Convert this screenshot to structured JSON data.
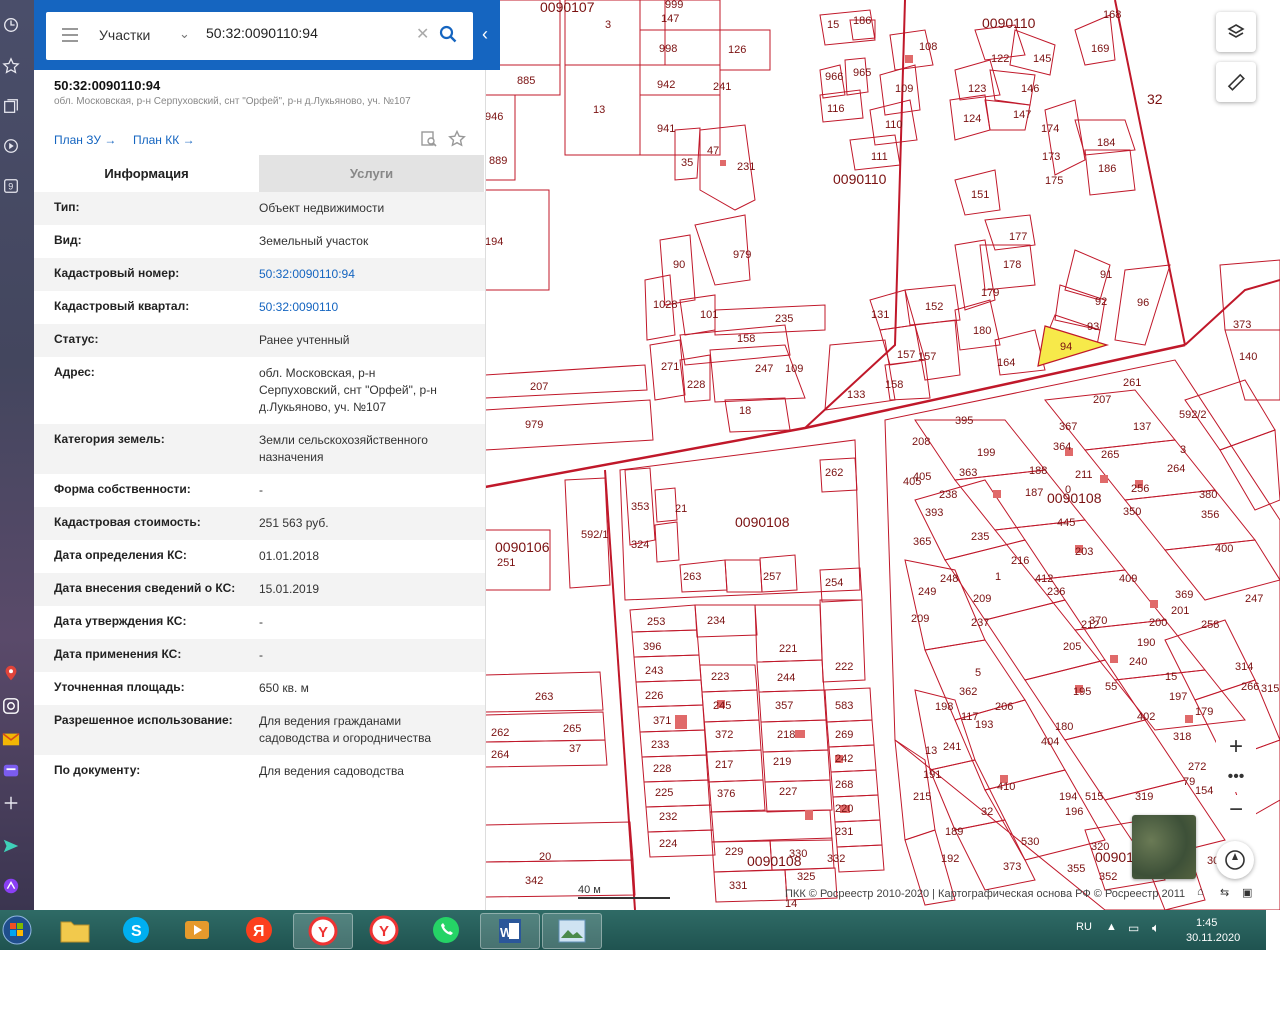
{
  "search": {
    "category": "Участки",
    "query": "50:32:0090110:94"
  },
  "object": {
    "cadastral_number": "50:32:0090110:94",
    "address_line": "обл. Московская, р-н Серпуховский, снт \"Орфей\", р-н д.Лукьяново, уч. №107",
    "plan_zu": "План ЗУ →",
    "plan_kk": "План КК →"
  },
  "tabs": {
    "info": "Информация",
    "services": "Услуги"
  },
  "properties": [
    {
      "key": "Тип:",
      "value": "Объект недвижимости"
    },
    {
      "key": "Вид:",
      "value": "Земельный участок"
    },
    {
      "key": "Кадастровый номер:",
      "value": "50:32:0090110:94",
      "link": true
    },
    {
      "key": "Кадастровый квартал:",
      "value": "50:32:0090110",
      "link": true
    },
    {
      "key": "Статус:",
      "value": "Ранее учтенный"
    },
    {
      "key": "Адрес:",
      "value": "обл. Московская, р-н Серпуховский, снт \"Орфей\", р-н д.Лукьяново, уч. №107"
    },
    {
      "key": "Категория земель:",
      "value": "Земли сельскохозяйственного назначения"
    },
    {
      "key": "Форма собственности:",
      "value": "-"
    },
    {
      "key": "Кадастровая стоимость:",
      "value": "251 563 руб."
    },
    {
      "key": "Дата определения КС:",
      "value": "01.01.2018"
    },
    {
      "key": "Дата внесения сведений о КС:",
      "value": "15.01.2019"
    },
    {
      "key": "Дата утверждения КС:",
      "value": "-"
    },
    {
      "key": "Дата применения КС:",
      "value": "-"
    },
    {
      "key": "Уточненная площадь:",
      "value": "650 кв. м"
    },
    {
      "key": "Разрешенное использование:",
      "value": "Для ведения гражданами садоводства и огородничества"
    },
    {
      "key": "По документу:",
      "value": "Для ведения садоводства"
    }
  ],
  "map": {
    "scale_label": "40 м",
    "copyright": "ПКК © Росреестр 2010-2020 | Картографическая основа РФ © Росреестр 2011",
    "quarter_labels": [
      "0090107",
      "0090110",
      "0090110",
      "32",
      "0090106",
      "0090108",
      "0090108",
      "0090108",
      "0090108"
    ],
    "parcel_labels": [
      "999",
      "147",
      "998",
      "942",
      "941",
      "3",
      "126",
      "241",
      "13",
      "885",
      "946",
      "889",
      "35",
      "47",
      "231",
      "15",
      "186",
      "966",
      "965",
      "116",
      "108",
      "109",
      "110",
      "111",
      "122",
      "145",
      "123",
      "146",
      "124",
      "147",
      "169",
      "168",
      "174",
      "184",
      "173",
      "186",
      "175",
      "151",
      "177",
      "178",
      "179",
      "180",
      "164",
      "194",
      "90",
      "979",
      "1028",
      "101",
      "235",
      "158",
      "131",
      "152",
      "157",
      "157",
      "158",
      "133",
      "91",
      "92",
      "93",
      "94",
      "96",
      "373",
      "140",
      "271",
      "228",
      "247",
      "109",
      "207",
      "18",
      "979",
      "261",
      "395",
      "367",
      "207",
      "137",
      "592/2",
      "208",
      "199",
      "364",
      "265",
      "3",
      "363",
      "211",
      "264",
      "405",
      "405",
      "238",
      "188",
      "256",
      "380",
      "393",
      "187",
      "0",
      "350",
      "356",
      "365",
      "445",
      "235",
      "216",
      "203",
      "400",
      "248",
      "1",
      "412",
      "409",
      "369",
      "247",
      "249",
      "209",
      "236",
      "370",
      "201",
      "209",
      "237",
      "212",
      "200",
      "258",
      "314",
      "5",
      "205",
      "190",
      "15",
      "315",
      "13",
      "362",
      "240",
      "197",
      "198",
      "193",
      "206",
      "195",
      "402",
      "179",
      "55",
      "272",
      "318",
      "180",
      "117",
      "266",
      "241",
      "404",
      "79",
      "191",
      "410",
      "215",
      "515",
      "32",
      "194",
      "319",
      "154",
      "189",
      "530",
      "196",
      "320",
      "304",
      "192",
      "373",
      "355",
      "352",
      "353",
      "324",
      "592/1",
      "21",
      "251",
      "263",
      "257",
      "262",
      "254",
      "253",
      "234",
      "396",
      "221",
      "243",
      "223",
      "244",
      "222",
      "226",
      "245",
      "357",
      "371",
      "583",
      "233",
      "372",
      "218",
      "269",
      "228",
      "217",
      "219",
      "242",
      "225",
      "376",
      "227",
      "268",
      "232",
      "220",
      "224",
      "231",
      "229",
      "330",
      "331",
      "325",
      "332",
      "14",
      "263",
      "262",
      "265",
      "264",
      "37",
      "20",
      "342"
    ],
    "selected_parcel": "94",
    "selected_color": "#f7e94a"
  },
  "taskbar": {
    "lang": "RU",
    "time": "1:45",
    "date": "30.11.2020"
  }
}
